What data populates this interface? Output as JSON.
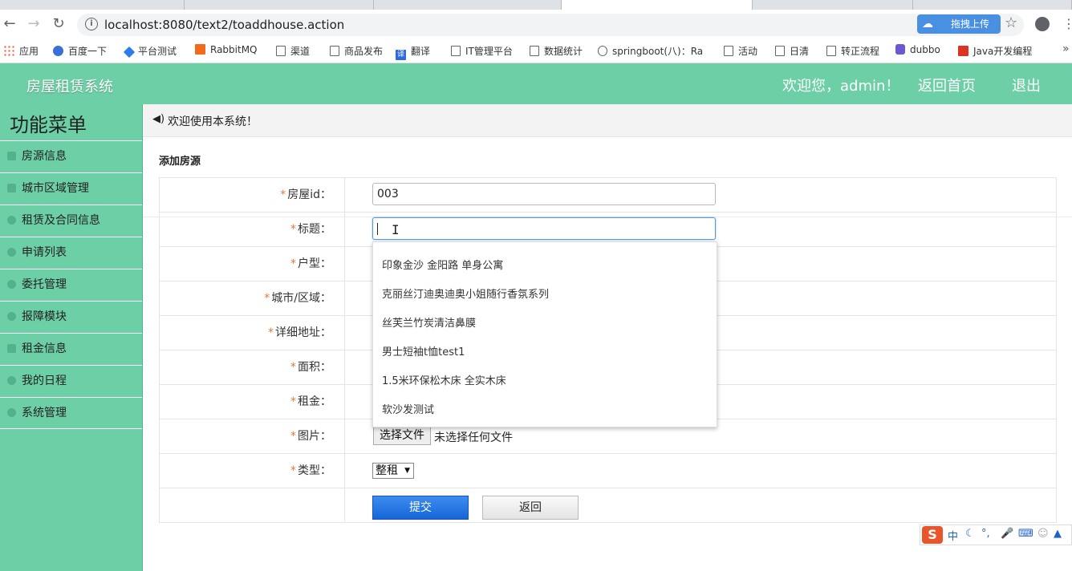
{
  "browser": {
    "tabs": [
      "",
      "",
      "",
      "",
      "",
      ""
    ],
    "url": "localhost:8080/text2/toaddhouse.action",
    "upload_label": "拖拽上传",
    "bookmarks": [
      "应用",
      "百度一下",
      "平台测试",
      "RabbitMQ",
      "渠道",
      "商品发布",
      "翻译",
      "IT管理平台",
      "数据统计",
      "springboot(八)：Ra",
      "活动",
      "日清",
      "转正流程",
      "dubbo",
      "Java开发编程"
    ]
  },
  "header": {
    "title": "房屋租赁系统",
    "welcome": "欢迎您，admin！",
    "home": "返回首页",
    "logout": "退出"
  },
  "sidebar": {
    "title": "功能菜单",
    "items": [
      "房源信息",
      "城市区域管理",
      "租赁及合同信息",
      "申请列表",
      "委托管理",
      "报障模块",
      "租金信息",
      "我的日程",
      "系统管理"
    ]
  },
  "main": {
    "welcome_text": "欢迎使用本系统！",
    "section_title": "添加房源",
    "fields": {
      "house_id": {
        "label": "房屋id：",
        "value": "003"
      },
      "title": {
        "label": "标题：",
        "value": ""
      },
      "layout": {
        "label": "户型："
      },
      "city": {
        "label": "城市/区域："
      },
      "address": {
        "label": "详细地址："
      },
      "area": {
        "label": "面积："
      },
      "rent": {
        "label": "租金："
      },
      "image": {
        "label": "图片：",
        "button": "选择文件",
        "status": "未选择任何文件"
      },
      "type": {
        "label": "类型：",
        "selected": "整租"
      }
    },
    "required_mark": "*",
    "autocomplete": [
      "印象金沙 金阳路 单身公寓",
      "克丽丝汀迪奥迪奥小姐随行香氛系列",
      "丝芙兰竹炭清洁鼻膜",
      "男士短袖t恤test1",
      "1.5米环保松木床 全实木床",
      "软沙发测试"
    ],
    "submit": "提交",
    "back": "返回"
  },
  "ime": {
    "mode": "中"
  }
}
